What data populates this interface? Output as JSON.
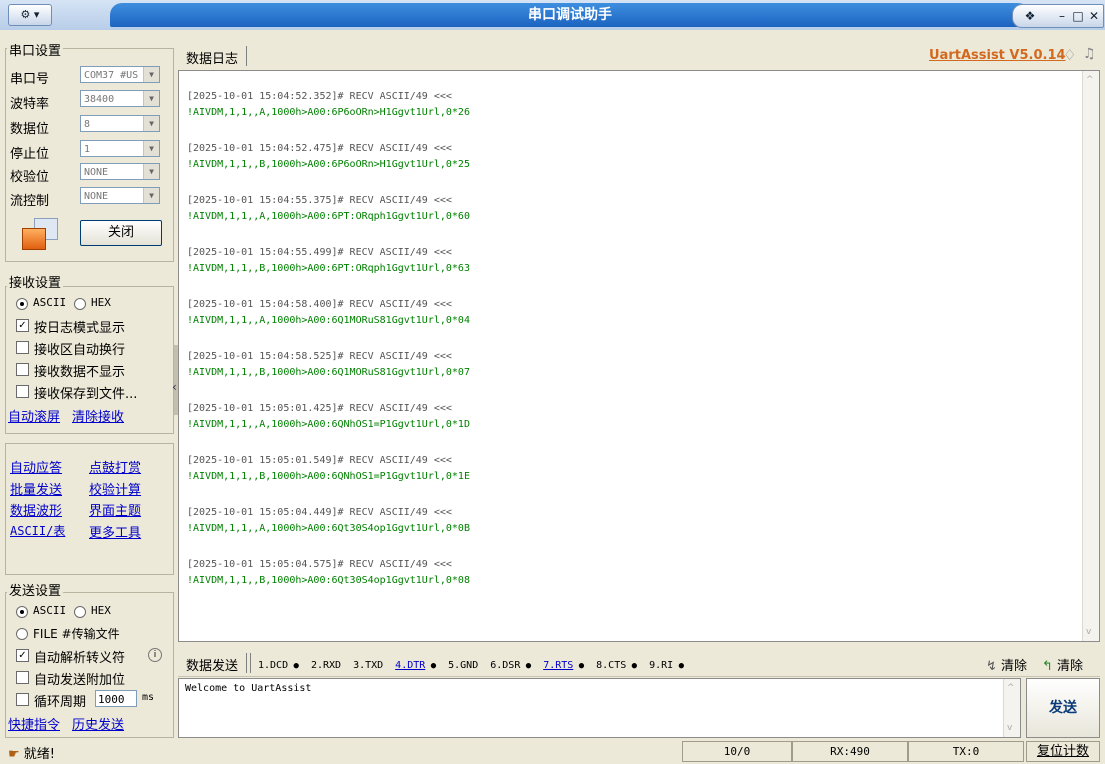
{
  "window": {
    "title": "串口调试助手",
    "menu": "▾"
  },
  "brand": {
    "name": "UartAssist V5.0.14"
  },
  "serial": {
    "group": "串口设置",
    "port_label": "串口号",
    "port_value": "COM37 #US",
    "baud_label": "波特率",
    "baud_value": "38400",
    "data_label": "数据位",
    "data_value": "8",
    "stop_label": "停止位",
    "stop_value": "1",
    "parity_label": "校验位",
    "parity_value": "NONE",
    "flow_label": "流控制",
    "flow_value": "NONE",
    "close_label": "关闭"
  },
  "recv": {
    "group": "接收设置",
    "ascii": "ASCII",
    "hex": "HEX",
    "opt1": "按日志模式显示",
    "opt2": "接收区自动换行",
    "opt3": "接收数据不显示",
    "opt4": "接收保存到文件...",
    "link1": "自动滚屏",
    "link2": "清除接收"
  },
  "tools": {
    "items": [
      "自动应答",
      "点鼓打赏",
      "批量发送",
      "校验计算",
      "数据波形",
      "界面主题",
      "ASCII/表",
      "更多工具"
    ]
  },
  "send": {
    "group": "发送设置",
    "ascii": "ASCII",
    "hex": "HEX",
    "file": "FILE #传输文件",
    "opt1": "自动解析转义符",
    "opt2": "自动发送附加位",
    "opt3": "循环周期",
    "cycle": "1000",
    "unit": "ms",
    "link1": "快捷指令",
    "link2": "历史发送"
  },
  "log": {
    "tab": "数据日志",
    "entries": [
      {
        "h": "[2025-10-01 15:04:52.352]# RECV ASCII/49 <<<",
        "d": "!AIVDM,1,1,,A,1000h>A00:6P6oORn>H1Ggvt1Url,0*26"
      },
      {
        "h": "[2025-10-01 15:04:52.475]# RECV ASCII/49 <<<",
        "d": "!AIVDM,1,1,,B,1000h>A00:6P6oORn>H1Ggvt1Url,0*25"
      },
      {
        "h": "[2025-10-01 15:04:55.375]# RECV ASCII/49 <<<",
        "d": "!AIVDM,1,1,,A,1000h>A00:6PT:ORqph1Ggvt1Url,0*60"
      },
      {
        "h": "[2025-10-01 15:04:55.499]# RECV ASCII/49 <<<",
        "d": "!AIVDM,1,1,,B,1000h>A00:6PT:ORqph1Ggvt1Url,0*63"
      },
      {
        "h": "[2025-10-01 15:04:58.400]# RECV ASCII/49 <<<",
        "d": "!AIVDM,1,1,,A,1000h>A00:6Q1MORuS81Ggvt1Url,0*04"
      },
      {
        "h": "[2025-10-01 15:04:58.525]# RECV ASCII/49 <<<",
        "d": "!AIVDM,1,1,,B,1000h>A00:6Q1MORuS81Ggvt1Url,0*07"
      },
      {
        "h": "[2025-10-01 15:05:01.425]# RECV ASCII/49 <<<",
        "d": "!AIVDM,1,1,,A,1000h>A00:6QNhOS1=P1Ggvt1Url,0*1D"
      },
      {
        "h": "[2025-10-01 15:05:01.549]# RECV ASCII/49 <<<",
        "d": "!AIVDM,1,1,,B,1000h>A00:6QNhOS1=P1Ggvt1Url,0*1E"
      },
      {
        "h": "[2025-10-01 15:05:04.449]# RECV ASCII/49 <<<",
        "d": "!AIVDM,1,1,,A,1000h>A00:6Qt30S4op1Ggvt1Url,0*0B"
      },
      {
        "h": "[2025-10-01 15:05:04.575]# RECV ASCII/49 <<<",
        "d": "!AIVDM,1,1,,B,1000h>A00:6Qt30S4op1Ggvt1Url,0*08"
      }
    ]
  },
  "sendbar": {
    "tab": "数据发送",
    "pins": [
      {
        "label": "1.DCD",
        "dot": true,
        "link": false
      },
      {
        "label": "2.RXD",
        "dot": false,
        "link": false
      },
      {
        "label": "3.TXD",
        "dot": false,
        "link": false
      },
      {
        "label": "4.DTR",
        "dot": true,
        "link": true
      },
      {
        "label": "5.GND",
        "dot": false,
        "link": false
      },
      {
        "label": "6.DSR",
        "dot": true,
        "link": false
      },
      {
        "label": "7.RTS",
        "dot": true,
        "link": true
      },
      {
        "label": "8.CTS",
        "dot": true,
        "link": false
      },
      {
        "label": "9.RI",
        "dot": true,
        "link": false
      }
    ],
    "clear1": "清除",
    "clear2": "清除",
    "input": "Welcome to UartAssist",
    "send_label": "发送"
  },
  "status": {
    "ready": "就绪!",
    "count": "10/0",
    "rx": "RX:490",
    "tx": "TX:0",
    "reset": "复位计数"
  },
  "colors": {
    "title": "#1c63c0",
    "brand": "#d2691e",
    "log_data": "#008000",
    "link": "#0000cc"
  }
}
